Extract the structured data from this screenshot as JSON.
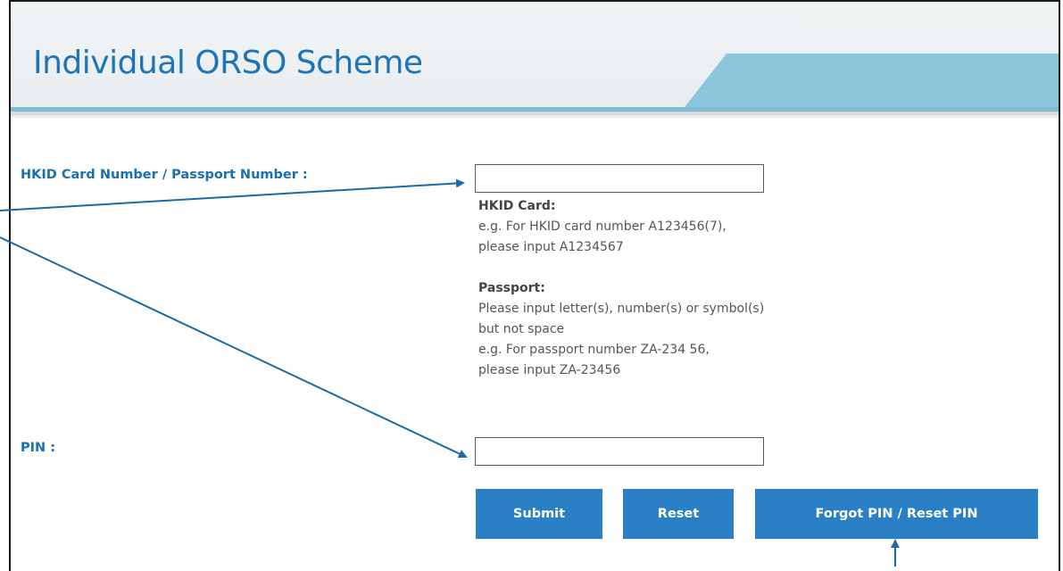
{
  "header": {
    "title": "Individual ORSO Scheme"
  },
  "form": {
    "id_label": "HKID Card Number / Passport Number :",
    "id_value": "",
    "pin_label": "PIN :",
    "pin_value": ""
  },
  "help": {
    "hkid_heading": "HKID Card:",
    "hkid_line1": "e.g. For HKID card number A123456(7),",
    "hkid_line2": "please input A1234567",
    "passport_heading": "Passport:",
    "passport_line1": "Please input letter(s), number(s) or symbol(s)",
    "passport_line2": "but not space",
    "passport_line3": "e.g. For passport number ZA-234 56,",
    "passport_line4": "please input ZA-23456"
  },
  "buttons": {
    "submit": "Submit",
    "reset": "Reset",
    "forgot": "Forgot PIN / Reset PIN"
  },
  "colors": {
    "accent": "#2b80c5",
    "title": "#1f74b5",
    "label": "#1a6fb0",
    "banner_band": "#8cc6dc",
    "annotation_arrow": "#1b6aa8"
  }
}
